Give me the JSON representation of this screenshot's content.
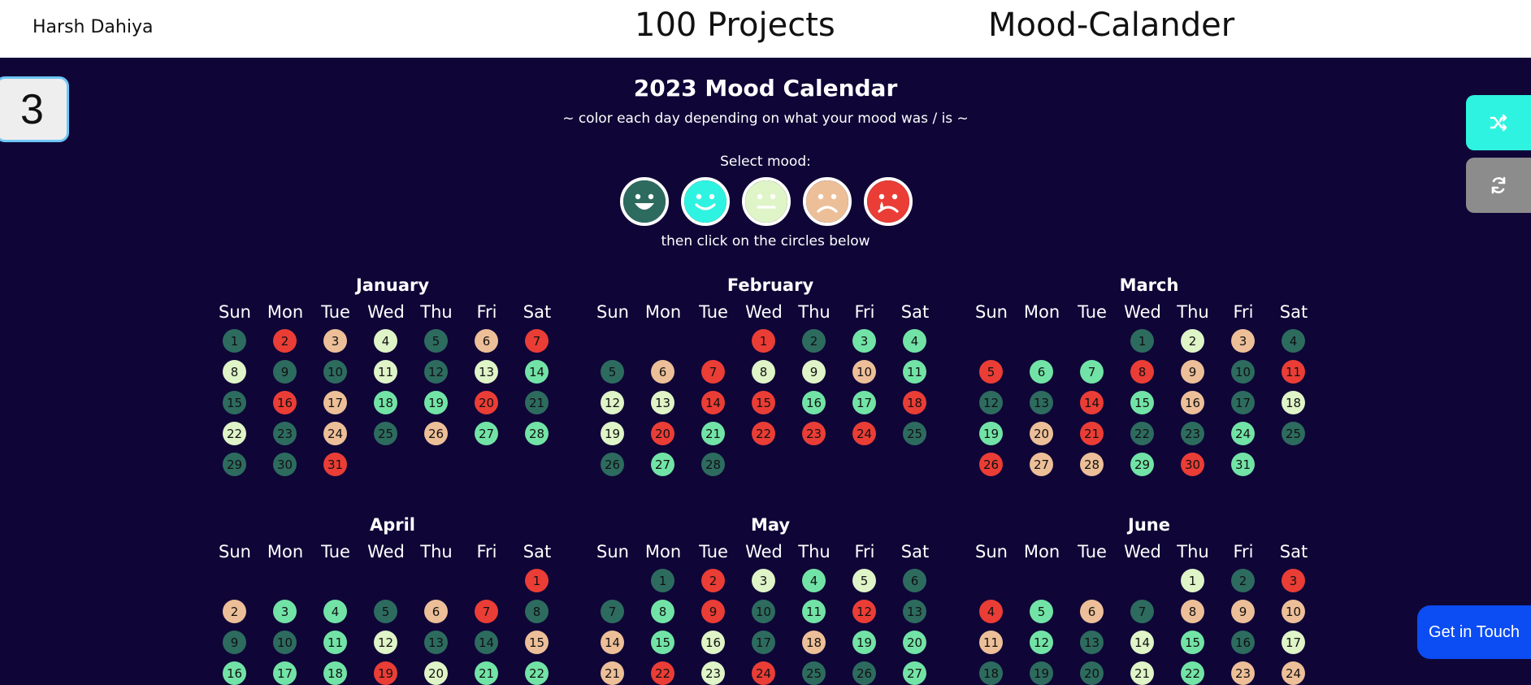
{
  "header": {
    "author": "Harsh Dahiya",
    "projects": "100 Projects",
    "project_name": "Mood-Calander"
  },
  "badge": {
    "number": "3"
  },
  "page": {
    "title": "2023 Mood Calendar",
    "subtitle": "~ color each day depending on what your mood was / is ~",
    "select_label": "Select mood:",
    "then_label": "then click on the circles below"
  },
  "contact": {
    "label": "Get in Touch"
  },
  "icons": {
    "shuffle": "shuffle-icon",
    "reload": "reload-icon"
  },
  "colors": {
    "background": "#0f0637",
    "mood_1": "#2d6b5f",
    "mood_2": "#72e3a6",
    "mood_3": "#dff4c7",
    "mood_4": "#edbf98",
    "mood_5": "#ea3d36",
    "shuffle_button": "#2ef3e1",
    "reload_button": "#8c8c8c",
    "contact_button": "#0b4cf3"
  },
  "moods": [
    {
      "name": "very-happy",
      "color": "#2d6b5f"
    },
    {
      "name": "happy",
      "color": "#2ef3e1"
    },
    {
      "name": "neutral",
      "color": "#dff4c7"
    },
    {
      "name": "sad",
      "color": "#edbf98"
    },
    {
      "name": "crying",
      "color": "#ea3d36"
    }
  ],
  "weekdays": [
    "Sun",
    "Mon",
    "Tue",
    "Wed",
    "Thu",
    "Fri",
    "Sat"
  ],
  "months": [
    {
      "name": "January",
      "start": 0,
      "days": [
        1,
        5,
        4,
        3,
        1,
        4,
        5,
        3,
        1,
        1,
        3,
        1,
        3,
        2,
        1,
        5,
        4,
        2,
        2,
        5,
        1,
        3,
        1,
        4,
        1,
        4,
        2,
        2,
        1,
        1,
        5
      ]
    },
    {
      "name": "February",
      "start": 3,
      "days": [
        5,
        1,
        2,
        2,
        1,
        4,
        5,
        3,
        3,
        4,
        2,
        3,
        3,
        5,
        5,
        2,
        2,
        5,
        3,
        5,
        2,
        5,
        5,
        5,
        1,
        1,
        2,
        1
      ]
    },
    {
      "name": "March",
      "start": 3,
      "days": [
        1,
        3,
        4,
        1,
        5,
        2,
        2,
        5,
        4,
        1,
        5,
        1,
        1,
        5,
        2,
        4,
        1,
        3,
        2,
        4,
        5,
        1,
        1,
        2,
        1,
        5,
        4,
        4,
        2,
        5,
        2
      ]
    },
    {
      "name": "April",
      "start": 6,
      "days": [
        5,
        4,
        2,
        2,
        1,
        4,
        5,
        1,
        1,
        1,
        2,
        3,
        1,
        1,
        4,
        2,
        2,
        2,
        5,
        3,
        2,
        2
      ]
    },
    {
      "name": "May",
      "start": 1,
      "days": [
        1,
        5,
        3,
        2,
        3,
        1,
        1,
        2,
        5,
        1,
        2,
        5,
        1,
        4,
        2,
        3,
        1,
        4,
        2,
        2,
        4,
        5,
        3,
        5,
        1,
        1,
        2
      ]
    },
    {
      "name": "June",
      "start": 4,
      "days": [
        3,
        1,
        5,
        5,
        2,
        4,
        1,
        4,
        4,
        4,
        4,
        2,
        1,
        3,
        2,
        1,
        3,
        1,
        1,
        1,
        3,
        2,
        4,
        4
      ]
    }
  ]
}
